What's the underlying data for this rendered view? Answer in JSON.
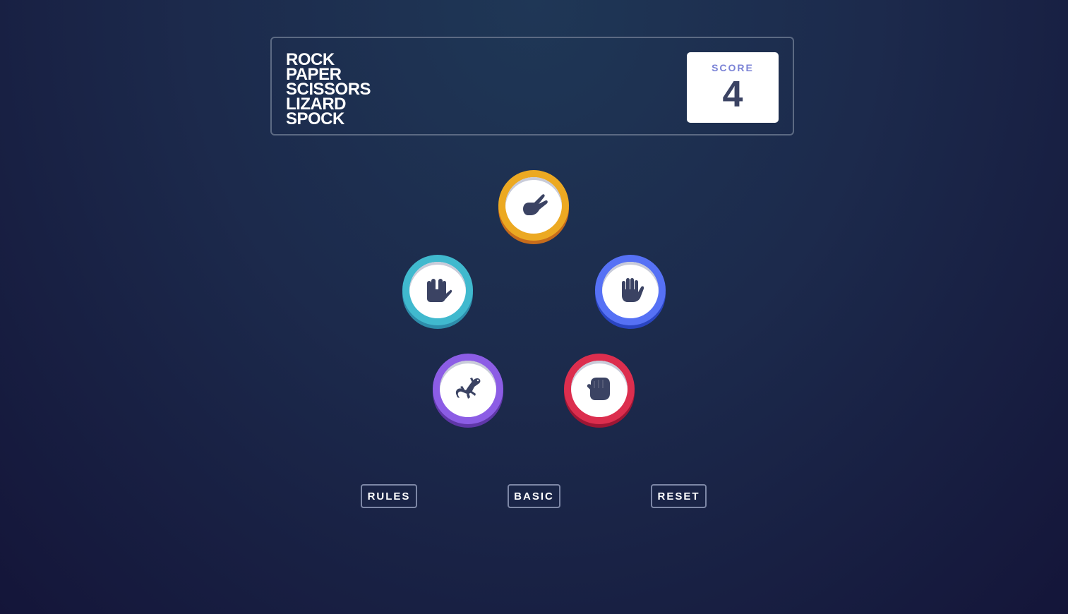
{
  "header": {
    "title_lines": [
      "ROCK",
      "PAPER",
      "SCISSORS",
      "LIZARD",
      "SPOCK"
    ],
    "score_label": "SCORE",
    "score_value": "4"
  },
  "tokens": [
    {
      "id": "scissors",
      "icon": "scissors-hand-icon",
      "color": "#eca922"
    },
    {
      "id": "spock",
      "icon": "spock-hand-icon",
      "color": "#40b9ce"
    },
    {
      "id": "paper",
      "icon": "paper-hand-icon",
      "color": "#5671f5"
    },
    {
      "id": "lizard",
      "icon": "lizard-icon",
      "color": "#8c5de5"
    },
    {
      "id": "rock",
      "icon": "rock-fist-icon",
      "color": "#dc2e4e"
    }
  ],
  "buttons": {
    "rules": "RULES",
    "basic": "BASIC",
    "reset": "RESET"
  },
  "colors": {
    "background_top": "#1f3756",
    "background_bottom": "#141539",
    "icon": "#3b4363",
    "score_label": "#7a82d6"
  }
}
